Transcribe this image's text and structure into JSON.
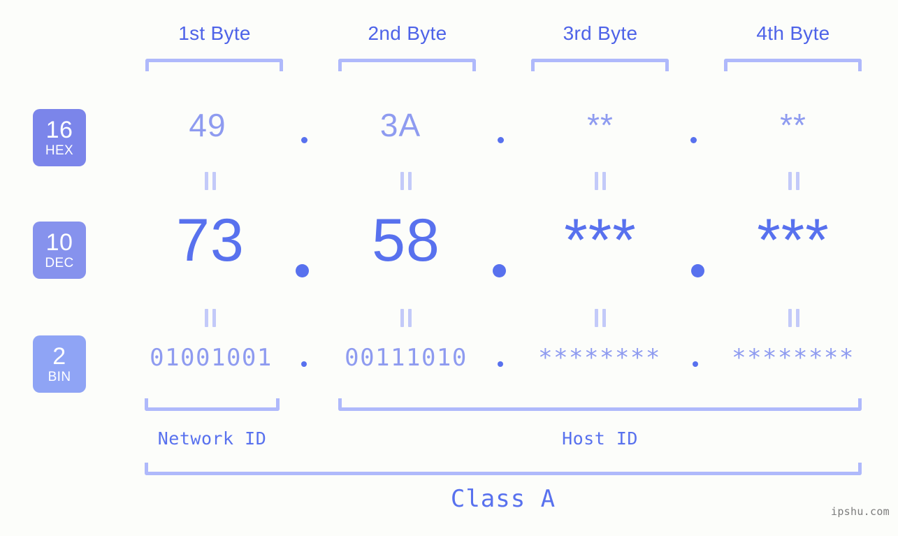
{
  "background_color": "#fcfdfa",
  "accent_strong": "#5871ee",
  "accent_light": "#8e9bf0",
  "bracket_color": "#afb9fb",
  "header": {
    "byte_labels": [
      {
        "label": "1st Byte"
      },
      {
        "label": "2nd Byte"
      },
      {
        "label": "3rd Byte"
      },
      {
        "label": "4th Byte"
      }
    ]
  },
  "bases": [
    {
      "number": "16",
      "name": "HEX",
      "color": "#7b85ea"
    },
    {
      "number": "10",
      "name": "DEC",
      "color": "#8692ed"
    },
    {
      "number": "2",
      "name": "BIN",
      "color": "#8fa4f5"
    }
  ],
  "rows": {
    "hex": {
      "base_number": "16",
      "base_name": "HEX",
      "values": [
        "49",
        "3A",
        "**",
        "**"
      ]
    },
    "dec": {
      "base_number": "10",
      "base_name": "DEC",
      "values": [
        "73",
        "58",
        "***",
        "***"
      ]
    },
    "bin": {
      "base_number": "2",
      "base_name": "BIN",
      "values": [
        "01001001",
        "00111010",
        "********",
        "********"
      ]
    }
  },
  "separator": ".",
  "equals_marker": "=",
  "footer": {
    "network_id_label": "Network ID",
    "host_id_label": "Host ID",
    "class_label": "Class A"
  },
  "watermark": "ipshu.com"
}
